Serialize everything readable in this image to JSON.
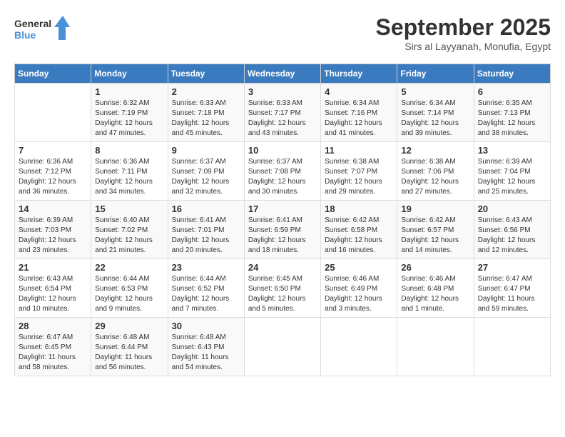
{
  "header": {
    "logo_line1": "General",
    "logo_line2": "Blue",
    "month": "September 2025",
    "location": "Sirs al Layyanah, Monufia, Egypt"
  },
  "days_of_week": [
    "Sunday",
    "Monday",
    "Tuesday",
    "Wednesday",
    "Thursday",
    "Friday",
    "Saturday"
  ],
  "weeks": [
    [
      {
        "day": "",
        "info": ""
      },
      {
        "day": "1",
        "info": "Sunrise: 6:32 AM\nSunset: 7:19 PM\nDaylight: 12 hours\nand 47 minutes."
      },
      {
        "day": "2",
        "info": "Sunrise: 6:33 AM\nSunset: 7:18 PM\nDaylight: 12 hours\nand 45 minutes."
      },
      {
        "day": "3",
        "info": "Sunrise: 6:33 AM\nSunset: 7:17 PM\nDaylight: 12 hours\nand 43 minutes."
      },
      {
        "day": "4",
        "info": "Sunrise: 6:34 AM\nSunset: 7:16 PM\nDaylight: 12 hours\nand 41 minutes."
      },
      {
        "day": "5",
        "info": "Sunrise: 6:34 AM\nSunset: 7:14 PM\nDaylight: 12 hours\nand 39 minutes."
      },
      {
        "day": "6",
        "info": "Sunrise: 6:35 AM\nSunset: 7:13 PM\nDaylight: 12 hours\nand 38 minutes."
      }
    ],
    [
      {
        "day": "7",
        "info": "Sunrise: 6:36 AM\nSunset: 7:12 PM\nDaylight: 12 hours\nand 36 minutes."
      },
      {
        "day": "8",
        "info": "Sunrise: 6:36 AM\nSunset: 7:11 PM\nDaylight: 12 hours\nand 34 minutes."
      },
      {
        "day": "9",
        "info": "Sunrise: 6:37 AM\nSunset: 7:09 PM\nDaylight: 12 hours\nand 32 minutes."
      },
      {
        "day": "10",
        "info": "Sunrise: 6:37 AM\nSunset: 7:08 PM\nDaylight: 12 hours\nand 30 minutes."
      },
      {
        "day": "11",
        "info": "Sunrise: 6:38 AM\nSunset: 7:07 PM\nDaylight: 12 hours\nand 29 minutes."
      },
      {
        "day": "12",
        "info": "Sunrise: 6:38 AM\nSunset: 7:06 PM\nDaylight: 12 hours\nand 27 minutes."
      },
      {
        "day": "13",
        "info": "Sunrise: 6:39 AM\nSunset: 7:04 PM\nDaylight: 12 hours\nand 25 minutes."
      }
    ],
    [
      {
        "day": "14",
        "info": "Sunrise: 6:39 AM\nSunset: 7:03 PM\nDaylight: 12 hours\nand 23 minutes."
      },
      {
        "day": "15",
        "info": "Sunrise: 6:40 AM\nSunset: 7:02 PM\nDaylight: 12 hours\nand 21 minutes."
      },
      {
        "day": "16",
        "info": "Sunrise: 6:41 AM\nSunset: 7:01 PM\nDaylight: 12 hours\nand 20 minutes."
      },
      {
        "day": "17",
        "info": "Sunrise: 6:41 AM\nSunset: 6:59 PM\nDaylight: 12 hours\nand 18 minutes."
      },
      {
        "day": "18",
        "info": "Sunrise: 6:42 AM\nSunset: 6:58 PM\nDaylight: 12 hours\nand 16 minutes."
      },
      {
        "day": "19",
        "info": "Sunrise: 6:42 AM\nSunset: 6:57 PM\nDaylight: 12 hours\nand 14 minutes."
      },
      {
        "day": "20",
        "info": "Sunrise: 6:43 AM\nSunset: 6:56 PM\nDaylight: 12 hours\nand 12 minutes."
      }
    ],
    [
      {
        "day": "21",
        "info": "Sunrise: 6:43 AM\nSunset: 6:54 PM\nDaylight: 12 hours\nand 10 minutes."
      },
      {
        "day": "22",
        "info": "Sunrise: 6:44 AM\nSunset: 6:53 PM\nDaylight: 12 hours\nand 9 minutes."
      },
      {
        "day": "23",
        "info": "Sunrise: 6:44 AM\nSunset: 6:52 PM\nDaylight: 12 hours\nand 7 minutes."
      },
      {
        "day": "24",
        "info": "Sunrise: 6:45 AM\nSunset: 6:50 PM\nDaylight: 12 hours\nand 5 minutes."
      },
      {
        "day": "25",
        "info": "Sunrise: 6:46 AM\nSunset: 6:49 PM\nDaylight: 12 hours\nand 3 minutes."
      },
      {
        "day": "26",
        "info": "Sunrise: 6:46 AM\nSunset: 6:48 PM\nDaylight: 12 hours\nand 1 minute."
      },
      {
        "day": "27",
        "info": "Sunrise: 6:47 AM\nSunset: 6:47 PM\nDaylight: 11 hours\nand 59 minutes."
      }
    ],
    [
      {
        "day": "28",
        "info": "Sunrise: 6:47 AM\nSunset: 6:45 PM\nDaylight: 11 hours\nand 58 minutes."
      },
      {
        "day": "29",
        "info": "Sunrise: 6:48 AM\nSunset: 6:44 PM\nDaylight: 11 hours\nand 56 minutes."
      },
      {
        "day": "30",
        "info": "Sunrise: 6:48 AM\nSunset: 6:43 PM\nDaylight: 11 hours\nand 54 minutes."
      },
      {
        "day": "",
        "info": ""
      },
      {
        "day": "",
        "info": ""
      },
      {
        "day": "",
        "info": ""
      },
      {
        "day": "",
        "info": ""
      }
    ]
  ]
}
